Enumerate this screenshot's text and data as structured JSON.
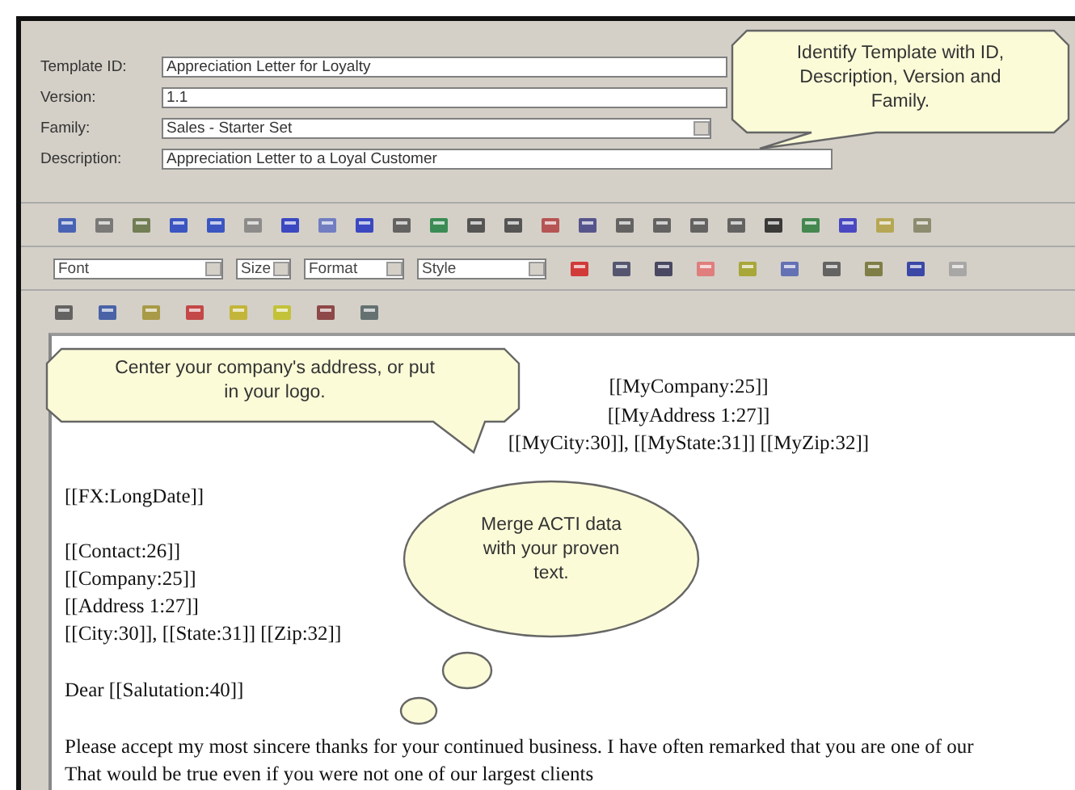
{
  "form": {
    "fields": [
      {
        "label": "Template ID:",
        "value": "Appreciation Letter for Loyalty",
        "kind": "text"
      },
      {
        "label": "Version:",
        "value": "1.1",
        "kind": "text"
      },
      {
        "label": "Family:",
        "value": "Sales - Starter Set",
        "kind": "select"
      },
      {
        "label": "Description:",
        "value": "Appreciation Letter to a Loyal Customer",
        "kind": "text"
      }
    ]
  },
  "toolbar": {
    "dropdowns": [
      {
        "label": "Font"
      },
      {
        "label": "Size"
      },
      {
        "label": "Format"
      },
      {
        "label": "Style"
      }
    ]
  },
  "letter": {
    "sender_lines": [
      "[[MyCompany:25]]",
      "[[MyAddress 1:27]]",
      "[[MyCity:30]], [[MyState:31]] [[MyZip:32]]"
    ],
    "date": "[[FX:LongDate]]",
    "recipient_lines": [
      "[[Contact:26]]",
      "[[Company:25]]",
      "[[Address 1:27]]",
      "[[City:30]], [[State:31]] [[Zip:32]]"
    ],
    "greeting": "Dear [[Salutation:40]]",
    "body_lines": [
      "Please accept my most sincere thanks for your continued business. I have often remarked that you are one of our",
      "That would be true even if you were not one of our largest clients"
    ]
  },
  "callouts": [
    {
      "kind": "speech",
      "text": "Identify Template with ID, Description, Version and Family."
    },
    {
      "kind": "speech",
      "text": "Center your company's address, or put in your logo."
    },
    {
      "kind": "thought",
      "text": "Merge ACTI data with your proven text."
    }
  ]
}
